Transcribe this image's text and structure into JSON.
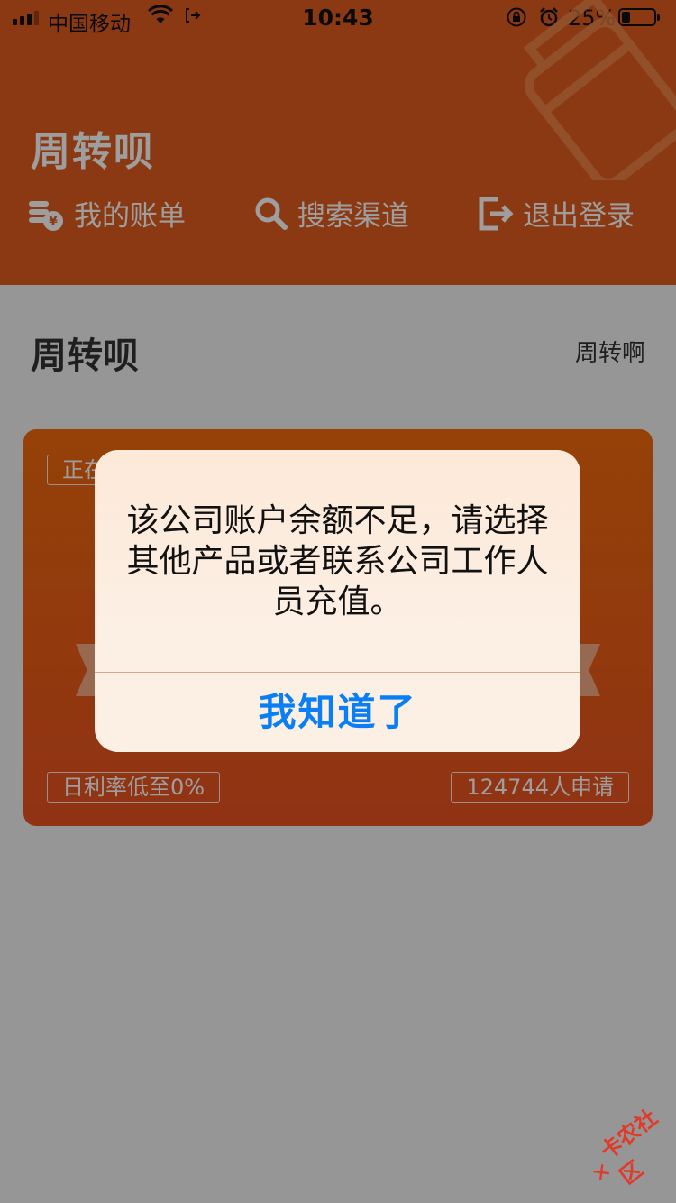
{
  "status_bar": {
    "carrier": "中国移动",
    "time": "10:43",
    "battery_percent_text": "25%",
    "battery_level": 0.25
  },
  "header": {
    "title": "周转呗",
    "nav": [
      {
        "label": "我的账单",
        "icon": "bill-coins-icon"
      },
      {
        "label": "搜索渠道",
        "icon": "search-icon"
      },
      {
        "label": "退出登录",
        "icon": "logout-icon"
      }
    ],
    "background_color": "#e15c1d"
  },
  "section": {
    "title": "周转呗",
    "subtitle": "周转啊"
  },
  "card": {
    "top_tag_partial": "正在",
    "left_tag": "日利率低至0%",
    "right_tag": "124744人申请"
  },
  "alert": {
    "message": "该公司账户余额不足，请选择其他产品或者联系公司工作人员充值。",
    "button_label": "我知道了",
    "button_color": "#0a7ff5"
  },
  "watermark": {
    "text": "卡农社区"
  }
}
